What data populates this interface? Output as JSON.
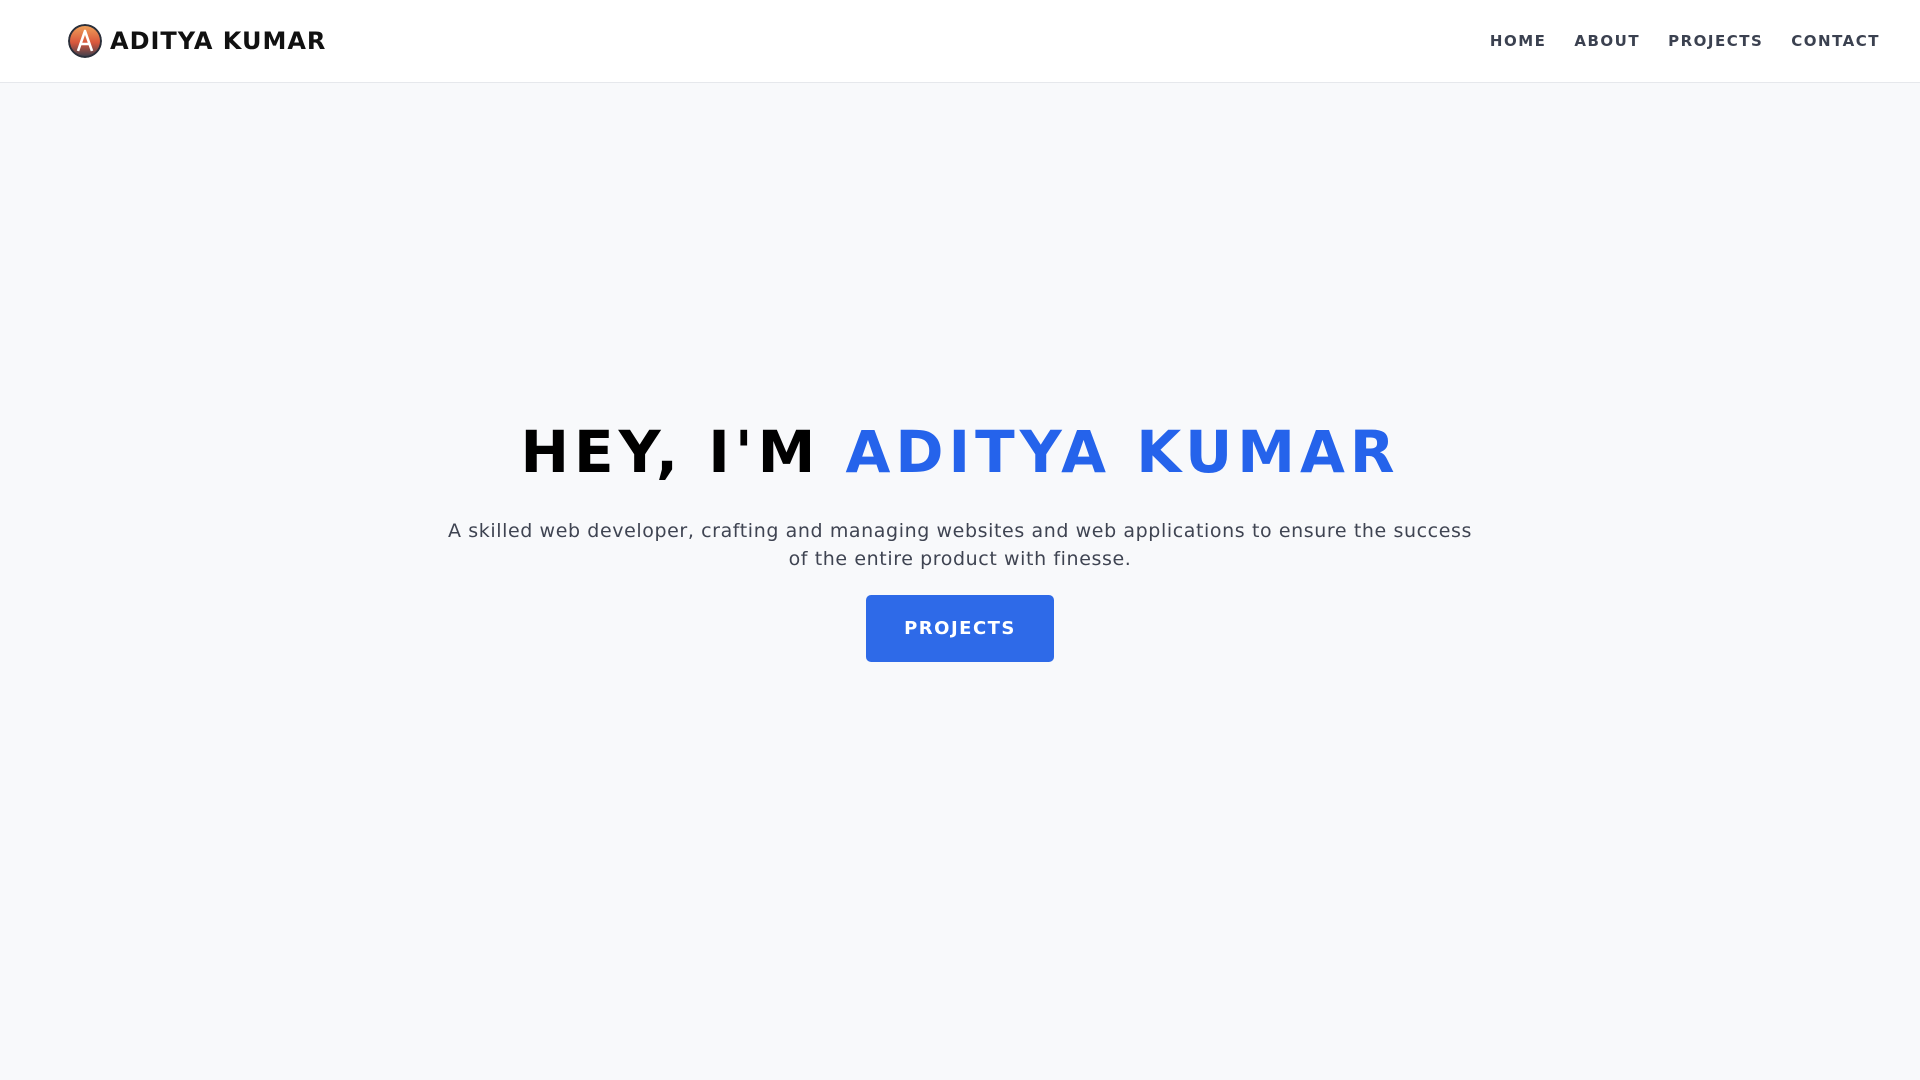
{
  "header": {
    "brand": "ADITYA KUMAR",
    "logo_icon": "avatar-logo-icon",
    "nav": [
      {
        "label": "HOME"
      },
      {
        "label": "ABOUT"
      },
      {
        "label": "PROJECTS"
      },
      {
        "label": "CONTACT"
      }
    ]
  },
  "hero": {
    "title_prefix": "HEY, I'M ",
    "title_name": "ADITYA KUMAR",
    "subtitle": "A skilled web developer, crafting and managing websites and web applications to ensure the success of the entire product with finesse.",
    "cta_label": "PROJECTS"
  },
  "colors": {
    "accent": "#2563eb",
    "button": "#2e6ae8",
    "background": "#f8f9fb",
    "header_bg": "#ffffff",
    "nav_text": "#3b4150"
  }
}
